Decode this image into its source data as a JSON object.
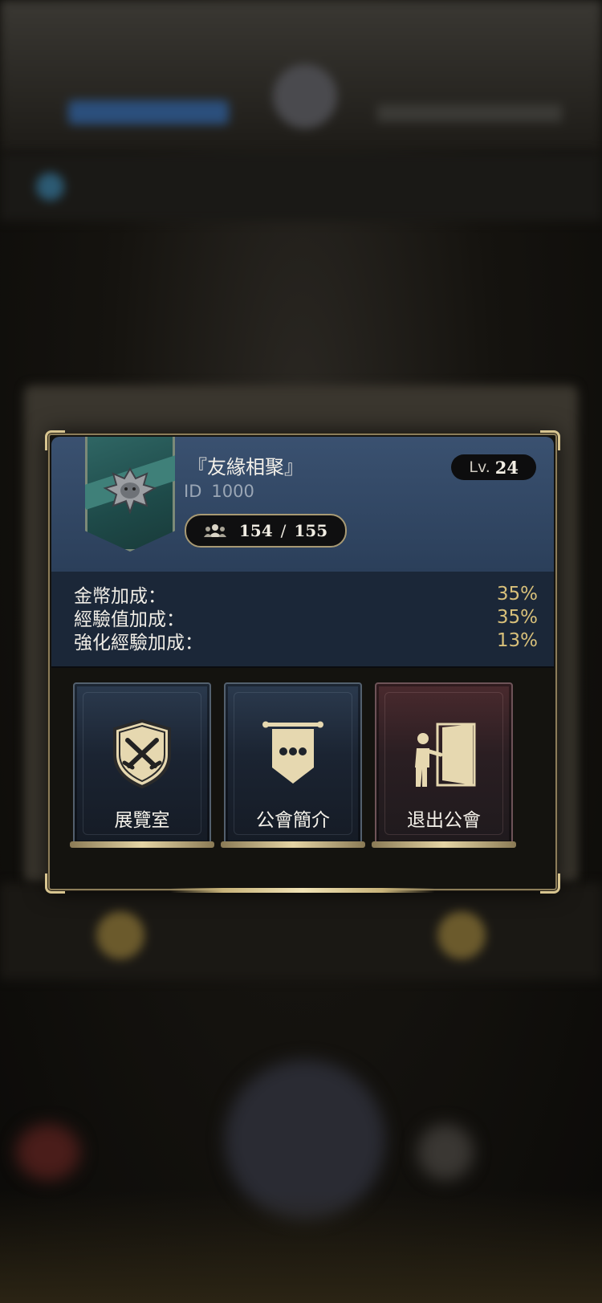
{
  "guild": {
    "name": "『友緣相聚』",
    "id_label": "ID",
    "id_value": "1000",
    "level_prefix": "Lv.",
    "level": "24",
    "members_current": "154",
    "members_separator": "/",
    "members_max": "155",
    "emblem_icon": "dragon-crest-icon",
    "members_icon": "group-icon"
  },
  "bonuses": [
    {
      "label": "金幣加成：",
      "value": "35%"
    },
    {
      "label": "經驗值加成：",
      "value": "35%"
    },
    {
      "label": "強化經驗加成：",
      "value": "13%"
    }
  ],
  "actions": {
    "exhibition": {
      "label": "展覽室",
      "icon": "shield-swords-icon"
    },
    "intro": {
      "label": "公會簡介",
      "icon": "banner-ellipsis-icon"
    },
    "leave": {
      "label": "退出公會",
      "icon": "exit-door-icon"
    }
  },
  "colors": {
    "header_blue": "#3a5170",
    "bonus_value_gold": "#d8c07a",
    "frame_gold": "#d8c590",
    "leave_red": "#4a2a2e"
  }
}
